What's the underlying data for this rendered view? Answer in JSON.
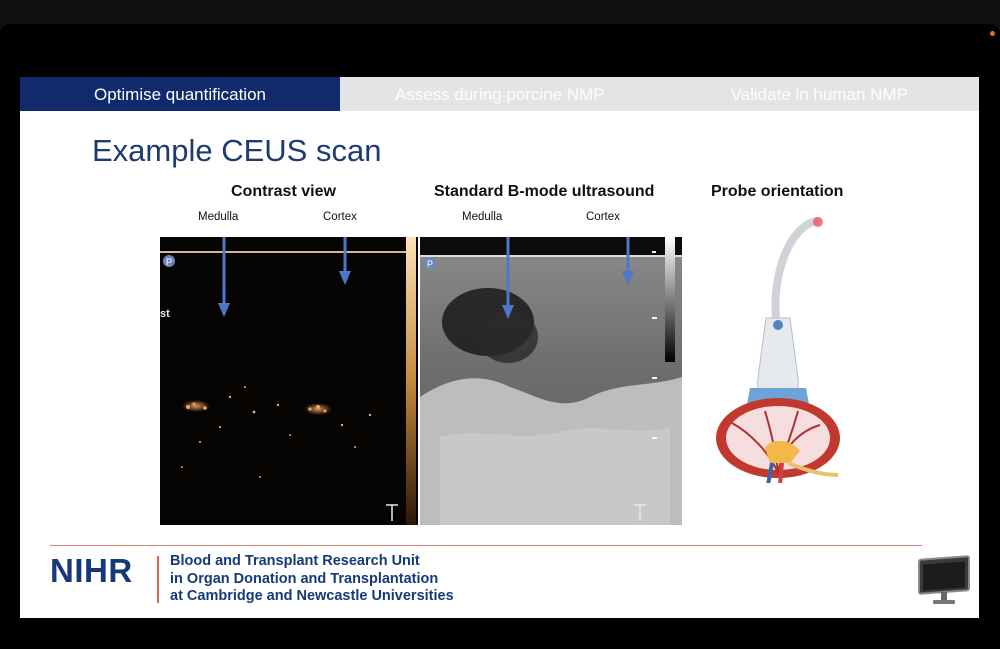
{
  "tabs": [
    {
      "label": "Optimise quantification",
      "active": true
    },
    {
      "label": "Assess during porcine NMP",
      "active": false
    },
    {
      "label": "Validate in human NMP",
      "active": false
    }
  ],
  "slide": {
    "title": "Example CEUS scan",
    "contrast": {
      "heading": "Contrast view",
      "medulla": "Medulla",
      "cortex": "Cortex",
      "side_label": "st",
      "marker": "P"
    },
    "bmode": {
      "heading": "Standard B-mode ultrasound",
      "medulla": "Medulla",
      "cortex": "Cortex",
      "marker": "P"
    },
    "probe": {
      "heading": "Probe orientation"
    }
  },
  "footer": {
    "logo": "NIHR",
    "line1": "Blood and Transplant Research Unit",
    "line2": "in Organ Donation and Transplantation",
    "line3": "at Cambridge and Newcastle Universities"
  },
  "icons": {
    "monitor": "monitor-icon",
    "rec": "recording-indicator-icon"
  },
  "colors": {
    "tab_active": "#102a6b",
    "title": "#1f3a72",
    "arrow": "#4d77c9",
    "accent": "#d46a54"
  }
}
